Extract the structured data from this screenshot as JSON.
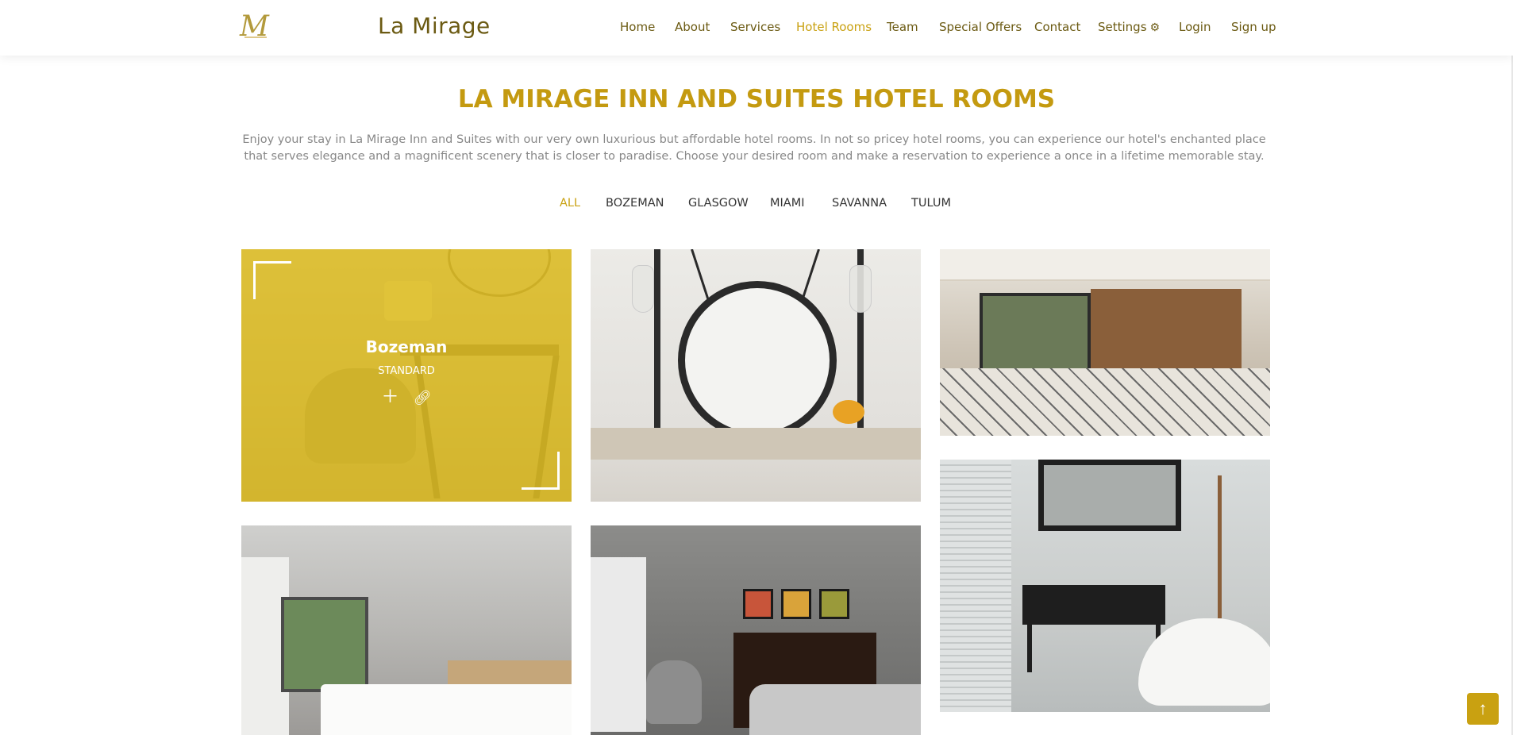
{
  "header": {
    "logo_glyph": "M",
    "brand": "La Mirage",
    "nav": [
      {
        "label": "Home"
      },
      {
        "label": "About"
      },
      {
        "label": "Services"
      },
      {
        "label": "Hotel Rooms",
        "active": true
      },
      {
        "label": "Team"
      },
      {
        "label": "Special Offers"
      },
      {
        "label": "Contact"
      },
      {
        "label": "Settings"
      },
      {
        "label": "Login"
      },
      {
        "label": "Sign up"
      }
    ],
    "settings_icon": "gears-icon"
  },
  "main": {
    "title": "LA MIRAGE INN AND SUITES HOTEL ROOMS",
    "intro": "Enjoy your stay in La Mirage Inn and Suites with our very own luxurious but affordable hotel rooms. In not so pricey hotel rooms, you can experience our hotel's enchanted place that serves elegance and a magnificent scenery that is closer to paradise. Choose your desired room and make a reservation to experience a once in a lifetime memorable stay.",
    "filters": [
      {
        "label": "ALL",
        "active": true
      },
      {
        "label": "BOZEMAN"
      },
      {
        "label": "GLASGOW"
      },
      {
        "label": "MIAMI"
      },
      {
        "label": "SAVANNA"
      },
      {
        "label": "TULUM"
      }
    ],
    "featured_card": {
      "title": "Bozeman",
      "subtitle": "STANDARD",
      "icons": [
        "plus-icon",
        "link-icon"
      ]
    }
  },
  "colors": {
    "accent": "#c9a111",
    "brand_text": "#6b5a12",
    "overlay": "#debe21"
  },
  "back_to_top_icon": "arrow-up-icon"
}
